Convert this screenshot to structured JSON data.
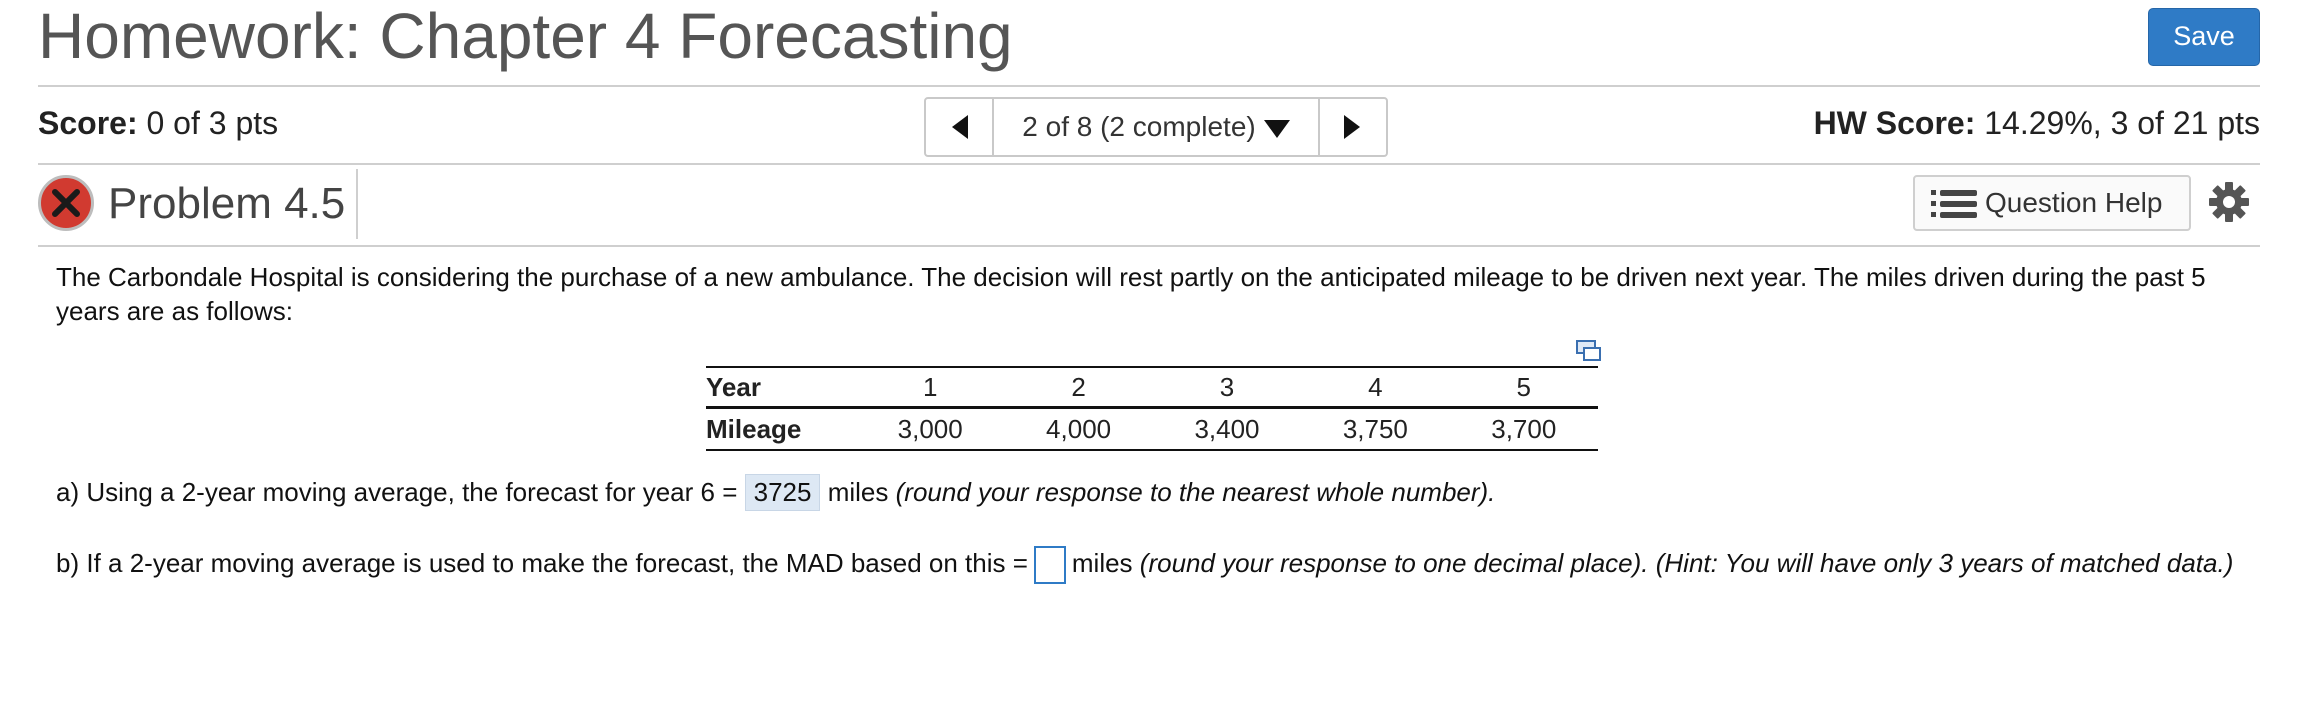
{
  "header": {
    "title": "Homework: Chapter 4 Forecasting",
    "save_label": "Save"
  },
  "scorebar": {
    "score_label": "Score:",
    "score_value": "0 of 3 pts",
    "nav_text": "2 of 8 (2 complete)",
    "hw_label": "HW Score:",
    "hw_value": "14.29%, 3 of 21 pts"
  },
  "problem": {
    "title": "Problem 4.5",
    "help_label": "Question Help"
  },
  "question": {
    "intro": "The Carbondale Hospital is considering the purchase of a new ambulance. The decision will rest partly on the anticipated mileage to be driven next year. The miles driven during the past 5 years are as follows:",
    "table": {
      "row1_label": "Year",
      "years": [
        "1",
        "2",
        "3",
        "4",
        "5"
      ],
      "row2_label": "Mileage",
      "mileage": [
        "3,000",
        "4,000",
        "3,400",
        "3,750",
        "3,700"
      ]
    },
    "a_prefix": "a) Using a 2-year moving average, the forecast for year 6 =",
    "a_answer": "3725",
    "a_suffix": "miles",
    "a_hint": "(round your response to the nearest whole number).",
    "b_prefix": "b) If a 2-year moving average is used to make the forecast, the MAD based on this =",
    "b_suffix": "miles",
    "b_hint": "(round your response to one decimal place).  (Hint: You will have only 3 years of matched data.)"
  }
}
